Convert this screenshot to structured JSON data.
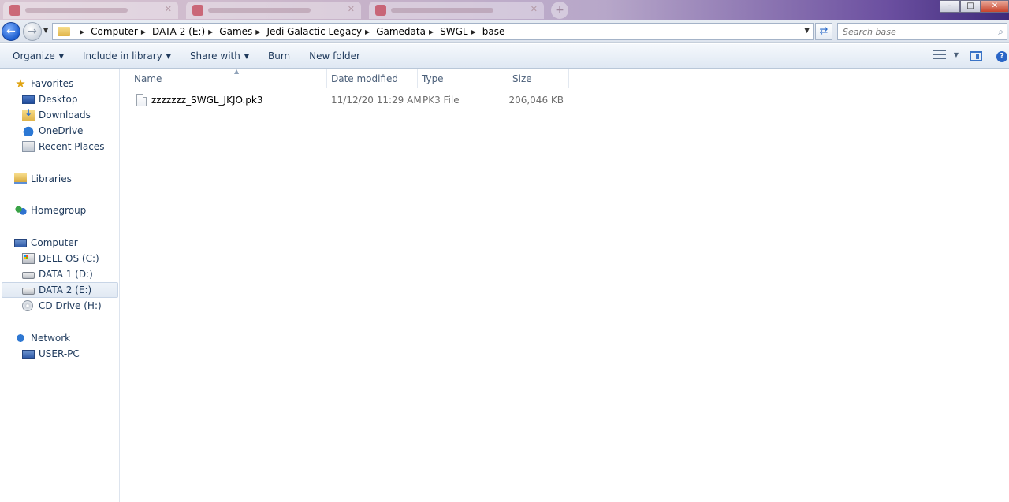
{
  "window": {
    "minimize": "–",
    "maximize": "□",
    "close": "✕"
  },
  "address": {
    "crumbs": [
      "Computer",
      "DATA 2 (E:)",
      "Games",
      "Jedi Galactic Legacy",
      "Gamedata",
      "SWGL",
      "base"
    ],
    "search_placeholder": "Search base"
  },
  "toolbar": {
    "organize": "Organize",
    "include": "Include in library",
    "share": "Share with",
    "burn": "Burn",
    "new_folder": "New folder",
    "help": "?"
  },
  "nav": {
    "favorites": "Favorites",
    "desktop": "Desktop",
    "downloads": "Downloads",
    "onedrive": "OneDrive",
    "recent": "Recent Places",
    "libraries": "Libraries",
    "homegroup": "Homegroup",
    "computer": "Computer",
    "drive_c": "DELL OS (C:)",
    "drive_d": "DATA 1 (D:)",
    "drive_e": "DATA 2 (E:)",
    "drive_h": "CD Drive (H:)",
    "network": "Network",
    "user_pc": "USER-PC"
  },
  "columns": {
    "name": "Name",
    "date": "Date modified",
    "type": "Type",
    "size": "Size"
  },
  "files": [
    {
      "name": "zzzzzzz_SWGL_JKJO.pk3",
      "date": "11/12/20 11:29 AM",
      "type": "PK3 File",
      "size": "206,046 KB"
    }
  ]
}
